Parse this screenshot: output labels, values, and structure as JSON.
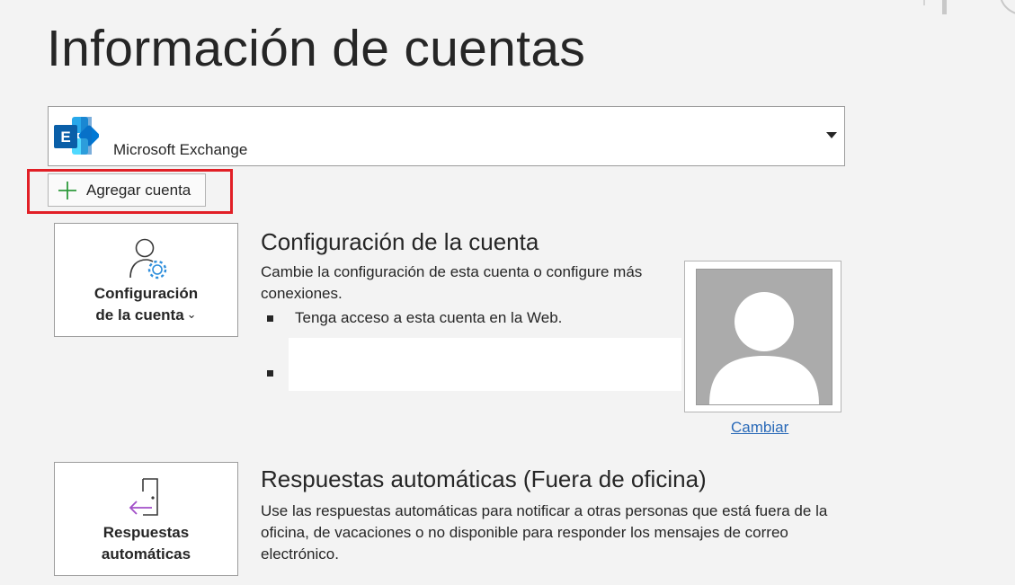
{
  "page": {
    "title": "Información de cuentas"
  },
  "account_selector": {
    "selected": "Microsoft Exchange",
    "logo_icon": "microsoft-exchange-icon",
    "logo_letter": "E"
  },
  "add_account": {
    "label": "Agregar cuenta",
    "icon": "plus-icon",
    "highlight_color": "#e11f26"
  },
  "account_settings": {
    "tile_label_line1": "Configuración",
    "tile_label_line2": "de la cuenta",
    "tile_chevron": "⌄",
    "tile_icon": "user-settings-icon",
    "heading": "Configuración de la cuenta",
    "description": "Cambie la configuración de esta cuenta o configure más conexiones.",
    "bullets": [
      "Tenga acceso a esta cuenta en la Web.",
      ""
    ]
  },
  "profile_photo": {
    "icon": "default-avatar-icon",
    "change_label": "Cambiar"
  },
  "automatic_replies": {
    "tile_label_line1": "Respuestas",
    "tile_label_line2": "automáticas",
    "tile_icon": "door-arrow-icon",
    "heading": "Respuestas automáticas (Fuera de oficina)",
    "description": "Use las respuestas automáticas para notificar a otras personas que está fuera de la oficina, de vacaciones o no disponible para responder los mensajes de correo electrónico."
  },
  "colors": {
    "link": "#2a6ab8",
    "plus_icon": "#2e9a3c",
    "exchange_blue": "#0f6cbd",
    "tile_icon_accent": "#2f8fdc",
    "door_arrow_accent": "#a24fc8"
  }
}
